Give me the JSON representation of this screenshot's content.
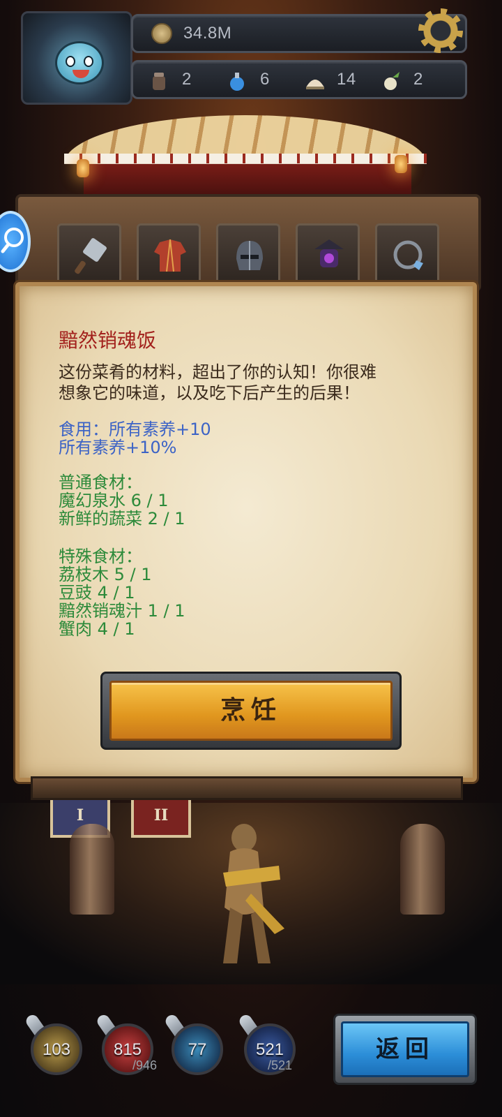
{
  "hud": {
    "gold": "34.8M",
    "resources": [
      {
        "icon": "jar-icon",
        "value": "2"
      },
      {
        "icon": "potion-icon",
        "value": "6"
      },
      {
        "icon": "rice-pile-icon",
        "value": "14"
      },
      {
        "icon": "radish-icon",
        "value": "2"
      }
    ]
  },
  "equipment": [
    {
      "icon": "cleaver-icon",
      "stars": "★★★"
    },
    {
      "icon": "robe-icon",
      "stars": "★★★"
    },
    {
      "icon": "helmet-icon",
      "stars": "★★★"
    },
    {
      "icon": "lantern-icon",
      "stars": "★★★★"
    },
    {
      "icon": "ring-icon",
      "stars": "★"
    }
  ],
  "dialog": {
    "title": "黯然销魂饭",
    "description_line1": "这份菜肴的材料，超出了你的认知！你很难",
    "description_line2": "想象它的味道，以及吃下后产生的后果！",
    "effect_line1": "食用：所有素养+10",
    "effect_line2": "所有素养+10%",
    "common_header": "普通食材：",
    "common": [
      "魔幻泉水 6 / 1",
      "新鲜的蔬菜 2 / 1"
    ],
    "special_header": "特殊食材：",
    "special": [
      "荔枝木 5 / 1",
      "豆豉 4 / 1",
      "黯然销魂汁 1 / 1",
      "蟹肉 4 / 1"
    ],
    "cook_label": "烹饪"
  },
  "banners": {
    "left": "I",
    "right": "II"
  },
  "stats": [
    {
      "icon": "yellow-orb-icon",
      "value": "103",
      "max": ""
    },
    {
      "icon": "red-orb-icon",
      "value": "815",
      "max": "/946"
    },
    {
      "icon": "blue-orb-icon",
      "value": "77",
      "max": ""
    },
    {
      "icon": "navy-orb-icon",
      "value": "521",
      "max": "/521"
    }
  ],
  "back_label": "返回",
  "colors": {
    "title_red": "#a2201c",
    "effect_blue": "#3c63c6",
    "ingredient_green": "#2c8a3a",
    "cook_orange": "#e0961e",
    "back_blue": "#2c8ed8"
  }
}
